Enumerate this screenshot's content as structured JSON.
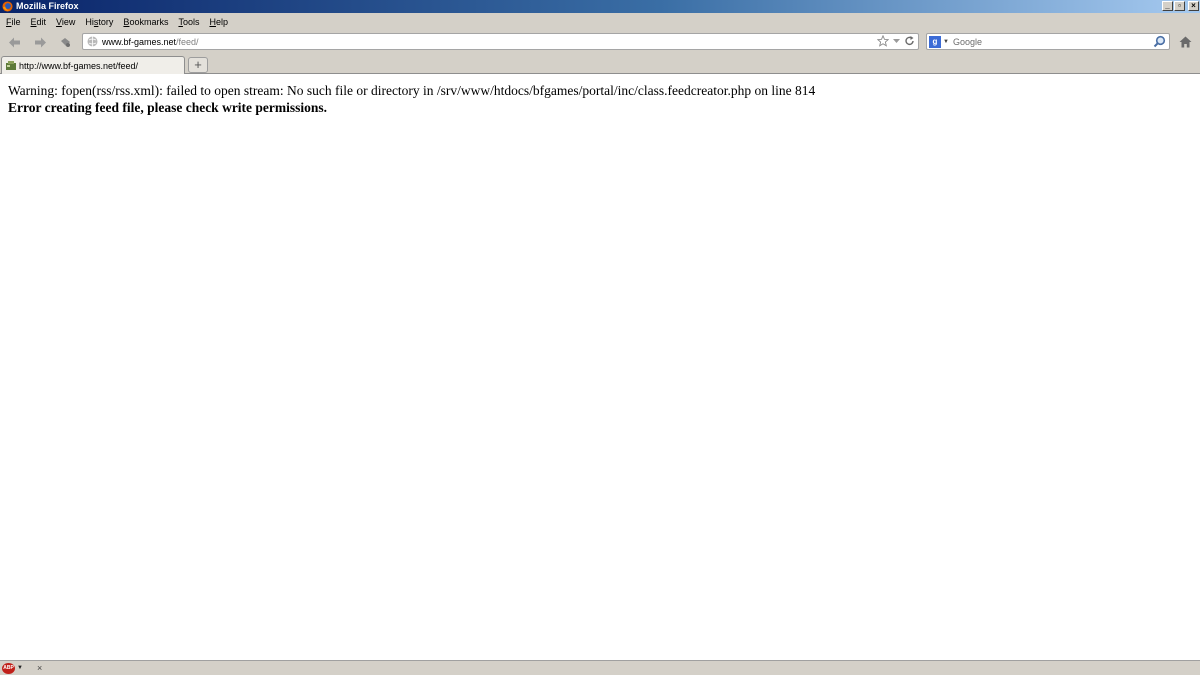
{
  "window": {
    "title": "Mozilla Firefox"
  },
  "menu": {
    "items": [
      {
        "acc": "F",
        "rest": "ile"
      },
      {
        "acc": "E",
        "rest": "dit"
      },
      {
        "acc": "V",
        "rest": "iew"
      },
      {
        "acc": "",
        "pre": "Hi",
        "accm": "s",
        "rest": "tory"
      },
      {
        "acc": "B",
        "rest": "ookmarks"
      },
      {
        "acc": "T",
        "rest": "ools"
      },
      {
        "acc": "H",
        "rest": "elp"
      }
    ]
  },
  "urlbar": {
    "host": "www.bf-games.net",
    "path": "/feed/"
  },
  "search": {
    "engine_letter": "g",
    "placeholder": "Google"
  },
  "tab": {
    "title": "http://www.bf-games.net/feed/"
  },
  "newtab": {
    "label": "+"
  },
  "content": {
    "warning": "Warning: fopen(rss/rss.xml): failed to open stream: No such file or directory in /srv/www/htdocs/bfgames/portal/inc/class.feedcreator.php on line 814",
    "error": "Error creating feed file, please check write permissions."
  },
  "statusbar": {
    "abp_label": "ABP",
    "close_label": "×"
  },
  "colors": {
    "title_gradient_start": "#0a246a",
    "chrome_bg": "#d4d0c8",
    "abp_red": "#c0201a"
  }
}
